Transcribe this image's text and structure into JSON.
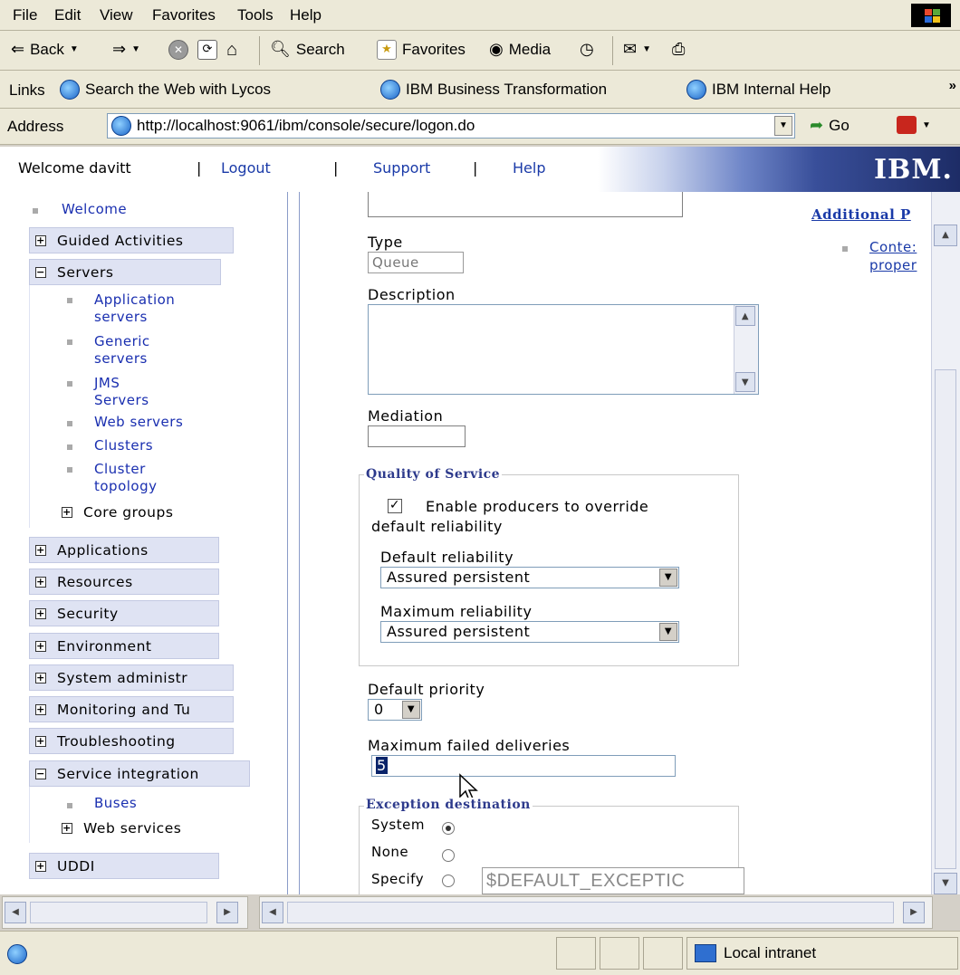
{
  "browser": {
    "menu": [
      "File",
      "Edit",
      "View",
      "Favorites",
      "Tools",
      "Help"
    ],
    "toolbar": {
      "back": "Back",
      "search": "Search",
      "favorites": "Favorites",
      "media": "Media"
    },
    "links": {
      "label": "Links",
      "items": [
        "Search the Web with Lycos",
        "IBM Business Transformation",
        "IBM Internal Help"
      ],
      "more": "»"
    },
    "address": {
      "label": "Address",
      "url": "http://localhost:9061/ibm/console/secure/logon.do",
      "go": "Go"
    },
    "status": {
      "zone": "Local intranet"
    }
  },
  "console": {
    "welcome": "Welcome davitt",
    "sep": "|",
    "logout": "Logout",
    "support": "Support",
    "help": "Help",
    "brand": "IBM."
  },
  "nav": {
    "welcome": "Welcome",
    "guided": "Guided Activities",
    "servers": "Servers",
    "servers_items": [
      {
        "l1": "Application",
        "l2": "servers"
      },
      {
        "l1": "Generic",
        "l2": "servers"
      },
      {
        "l1": "JMS",
        "l2": "Servers"
      },
      {
        "l1": "Web servers",
        "l2": ""
      },
      {
        "l1": "Clusters",
        "l2": ""
      },
      {
        "l1": "Cluster",
        "l2": "topology"
      }
    ],
    "core_groups": "Core groups",
    "applications": "Applications",
    "resources": "Resources",
    "security": "Security",
    "environment": "Environment",
    "system_admin": "System administr",
    "monitoring": "Monitoring and Tu",
    "troubleshooting": "Troubleshooting",
    "service_integration": "Service integration",
    "buses": "Buses",
    "web_services": "Web services",
    "uddi": "UDDI"
  },
  "form": {
    "type_label": "Type",
    "type_value": "Queue",
    "description_label": "Description",
    "mediation_label": "Mediation",
    "qos_legend": "Quality of Service",
    "override_label_1": "Enable producers to override",
    "override_label_2": "default reliability",
    "override_checked": true,
    "default_reliability_label": "Default reliability",
    "default_reliability_value": "Assured persistent",
    "max_reliability_label": "Maximum reliability",
    "max_reliability_value": "Assured persistent",
    "default_priority_label": "Default priority",
    "default_priority_value": "0",
    "max_failed_label": "Maximum failed deliveries",
    "max_failed_value": "5",
    "exception_legend": "Exception destination",
    "system": "System",
    "none": "None",
    "specify": "Specify",
    "specify_value": "$DEFAULT_EXCEPTIC",
    "selected": "System"
  },
  "right": {
    "additional": "Additional P",
    "link_1": "Conte:",
    "link_2": "proper"
  }
}
